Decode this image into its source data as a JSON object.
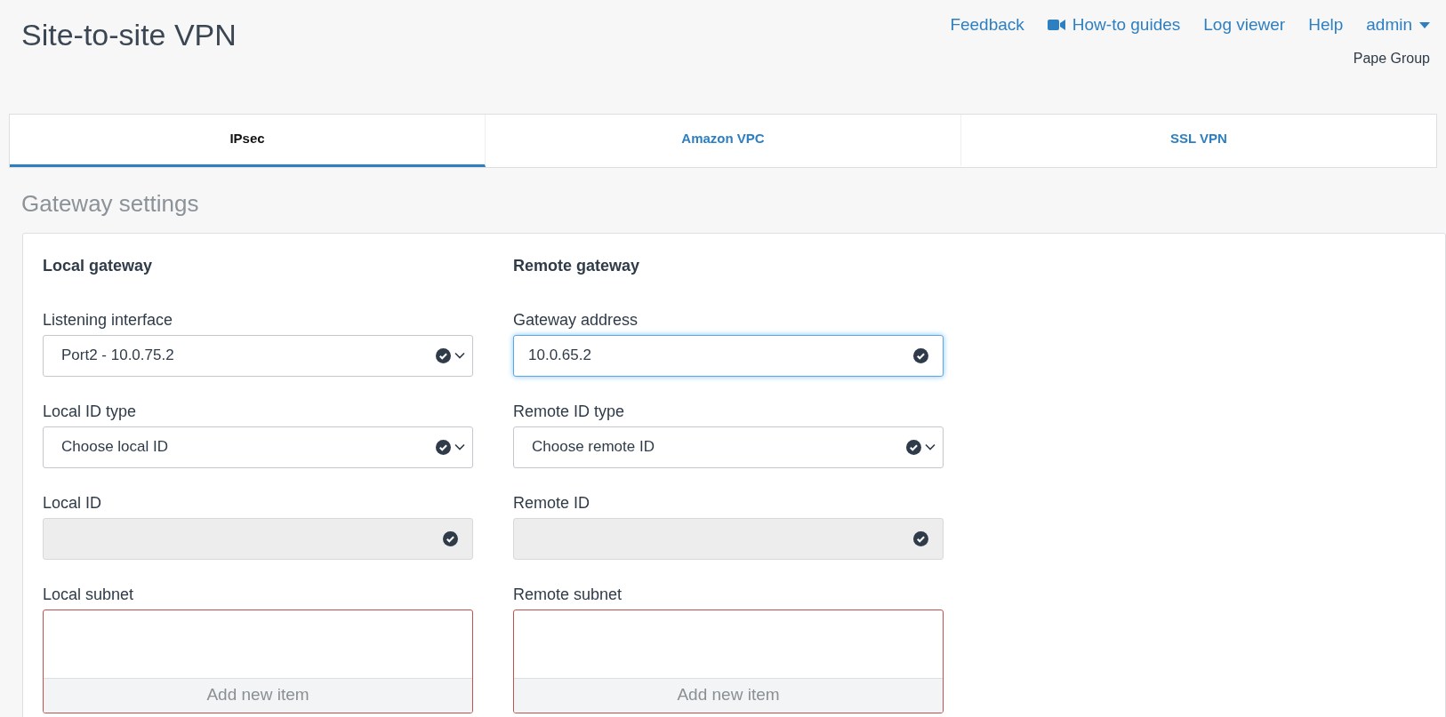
{
  "page_title": "Site-to-site VPN",
  "top_links": [
    {
      "kind": "link",
      "label": "Feedback"
    },
    {
      "kind": "video",
      "label": "How-to guides"
    },
    {
      "kind": "link",
      "label": "Log viewer"
    },
    {
      "kind": "link",
      "label": "Help"
    },
    {
      "kind": "menu",
      "label": "admin"
    }
  ],
  "organization": "Pape Group",
  "tabs": [
    {
      "label": "IPsec",
      "selected": true
    },
    {
      "label": "Amazon VPC",
      "selected": false
    },
    {
      "label": "SSL VPN",
      "selected": false
    }
  ],
  "section_title": "Gateway settings",
  "columns": [
    {
      "heading": "Local gateway",
      "fields": [
        {
          "label": "Listening interface",
          "kind": "select",
          "value": "Port2 - 10.0.75.2",
          "focused": false
        },
        {
          "label": "Local ID type",
          "kind": "select",
          "value": "Choose local ID",
          "focused": false
        },
        {
          "label": "Local ID",
          "kind": "disabled",
          "focused": false
        },
        {
          "label": "Local subnet",
          "kind": "list",
          "add_label": "Add new item",
          "invalid": true,
          "focused": false
        }
      ]
    },
    {
      "heading": "Remote gateway",
      "fields": [
        {
          "label": "Gateway address",
          "kind": "input",
          "value": "10.0.65.2",
          "focused": true
        },
        {
          "label": "Remote ID type",
          "kind": "select",
          "value": "Choose remote ID",
          "focused": false
        },
        {
          "label": "Remote ID",
          "kind": "disabled",
          "focused": false
        },
        {
          "label": "Remote subnet",
          "kind": "list",
          "add_label": "Add new item",
          "invalid": true,
          "focused": false
        }
      ]
    }
  ]
}
